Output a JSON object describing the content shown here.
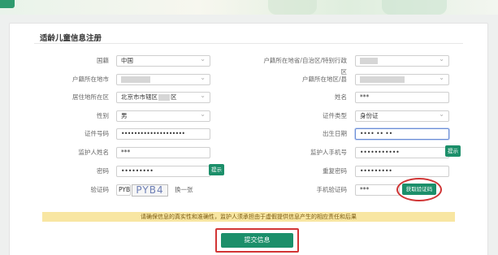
{
  "form": {
    "title": "适龄儿童信息注册",
    "fields": {
      "nationality": {
        "label": "国籍",
        "value": "中国"
      },
      "huji_province": {
        "label": "户籍所在地省/自治区/特别行政区"
      },
      "huji_city": {
        "label": "户籍所在地市"
      },
      "huji_district": {
        "label": "户籍所在地区/县"
      },
      "residence_district": {
        "label": "居住地所在区",
        "value": "北京市市辖区",
        "suffix": "区"
      },
      "name": {
        "label": "姓名",
        "value": "***"
      },
      "gender": {
        "label": "性别",
        "value": "男"
      },
      "id_type": {
        "label": "证件类型",
        "value": "身份证"
      },
      "id_number": {
        "label": "证件号码",
        "value": "••••••••••••••••••••"
      },
      "birth_date": {
        "label": "出生日期",
        "value": "•••• •• ••"
      },
      "guardian_name": {
        "label": "监护人姓名",
        "value": "***"
      },
      "guardian_phone": {
        "label": "监护人手机号",
        "value": "•••••••••••"
      },
      "password": {
        "label": "密码",
        "value": "•••••••••"
      },
      "confirm_password": {
        "label": "重复密码",
        "value": "•••••••••"
      },
      "captcha": {
        "label": "验证码",
        "value": "PYB4",
        "image_text": "PYB4",
        "refresh_label": "换一张"
      },
      "sms_code": {
        "label": "手机验证码",
        "value": "***"
      }
    },
    "hint_label": "提示",
    "get_code_label": "获取验证码",
    "notice": "请确保信息的真实性和准确性，监护人须承担由于虚假提供信息产生的相应责任和后果",
    "submit_label": "提交信息"
  },
  "colors": {
    "primary": "#1c8f6a",
    "highlight": "#d23535",
    "notice_bg": "#f8e6a2"
  }
}
